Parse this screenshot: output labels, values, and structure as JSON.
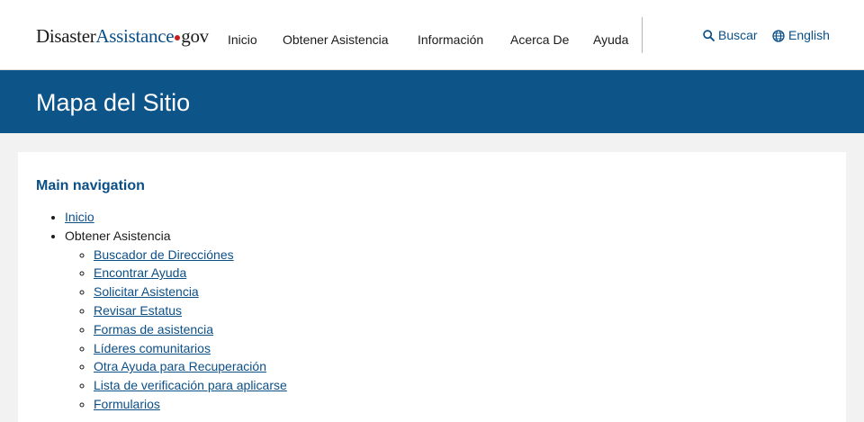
{
  "header": {
    "logo": {
      "part1": "Disaster",
      "part2": "Assistance",
      "part3": "gov"
    },
    "nav": [
      "Inicio",
      "Obtener Asistencia",
      "Información",
      "Acerca De",
      "Ayuda"
    ],
    "search_label": "Buscar",
    "language_label": "English"
  },
  "banner": {
    "title": "Mapa del Sitio"
  },
  "sitemap": {
    "heading": "Main navigation",
    "items": [
      {
        "label": "Inicio"
      },
      {
        "label": "Obtener Asistencia",
        "children": [
          "Buscador de Direcciónes",
          "Encontrar Ayuda",
          "Solicitar Asistencia",
          "Revisar Estatus",
          "Formas de asistencia",
          "Líderes comunitarios",
          "Otra Ayuda para Recuperación",
          "Lista de verificación para aplicarse",
          "Formularios"
        ]
      }
    ]
  },
  "colors": {
    "brand_blue": "#0b4f87",
    "banner_blue": "#0d5489",
    "logo_dot_red": "#c41e1e",
    "page_bg": "#f2f2f2"
  },
  "icons": {
    "search": "search-icon",
    "language": "globe-icon"
  }
}
